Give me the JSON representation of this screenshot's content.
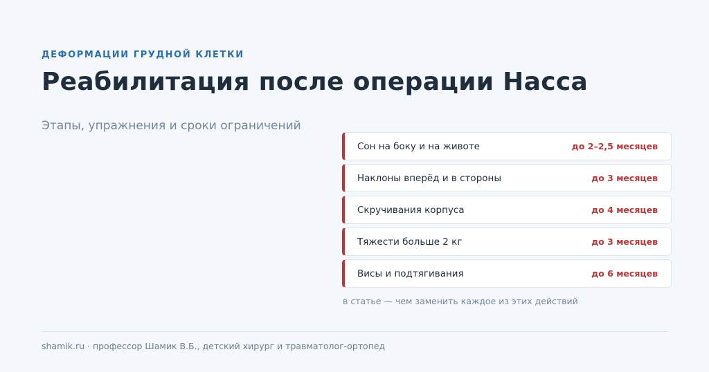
{
  "header": {
    "eyebrow": "ДЕФОРМАЦИИ ГРУДНОЙ КЛЕТКИ",
    "title": "Реабилитация после операции Насса",
    "subtitle": "Этапы, упражнения и сроки ограничений"
  },
  "limits": [
    {
      "label": "Сон на боку и на животе",
      "term": "до 2–2,5 месяцев"
    },
    {
      "label": "Наклоны вперёд и в стороны",
      "term": "до 3 месяцев"
    },
    {
      "label": "Скручивания корпуса",
      "term": "до 4 месяцев"
    },
    {
      "label": "Тяжести больше 2 кг",
      "term": "до 3 месяцев"
    },
    {
      "label": "Висы и подтягивания",
      "term": "до 6 месяцев"
    }
  ],
  "note": "в статье — чем заменить каждое из этих действий",
  "footer": "shamik.ru · профессор Шамик В.Б., детский хирург и травматолог-ортопед",
  "colors": {
    "accent": "#b23a3a",
    "eyebrow": "#2f6fa8",
    "background": "#f4f7fb"
  }
}
